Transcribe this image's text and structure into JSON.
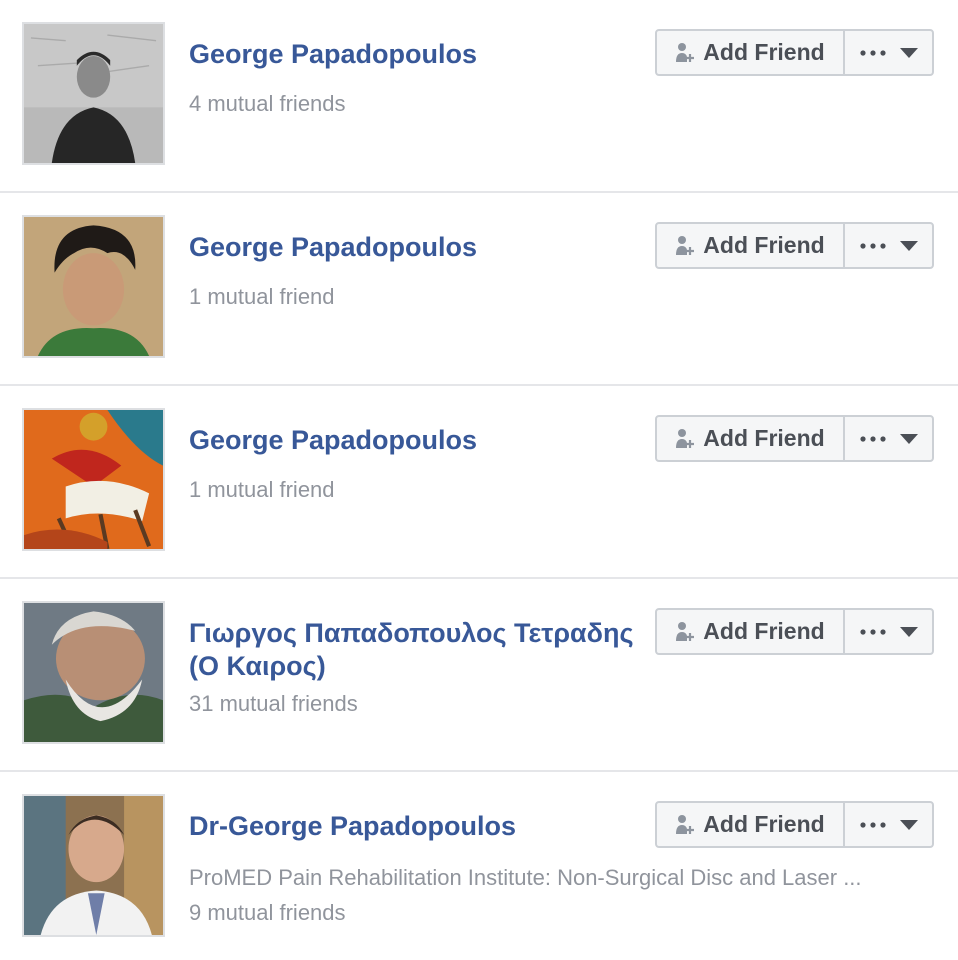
{
  "people": [
    {
      "name": "George Papadopoulos",
      "work": "",
      "mutual": "4 mutual friends",
      "add_label": "Add Friend"
    },
    {
      "name": "George Papadopoulos",
      "work": "",
      "mutual": "1 mutual friend",
      "add_label": "Add Friend"
    },
    {
      "name": "George Papadopoulos",
      "work": "",
      "mutual": "1 mutual friend",
      "add_label": "Add Friend"
    },
    {
      "name": "Γιωργος Παπαδοπουλος Τετραδης (Ο Καιρος)",
      "work": "",
      "mutual": "31 mutual friends",
      "add_label": "Add Friend"
    },
    {
      "name": "Dr-George Papadopoulos",
      "work": "ProMED Pain Rehabilitation Institute: Non-Surgical Disc and Laser ...",
      "mutual": "9 mutual friends",
      "add_label": "Add Friend"
    }
  ],
  "icons": {
    "add_friend": "add-friend-icon",
    "more": "more-options-icon",
    "dropdown": "chevron-down-icon"
  },
  "colors": {
    "name_link": "#385898",
    "secondary_text": "#90949c",
    "button_bg": "#f5f6f7",
    "button_border": "#ccd0d5",
    "button_text": "#4b4f56"
  }
}
